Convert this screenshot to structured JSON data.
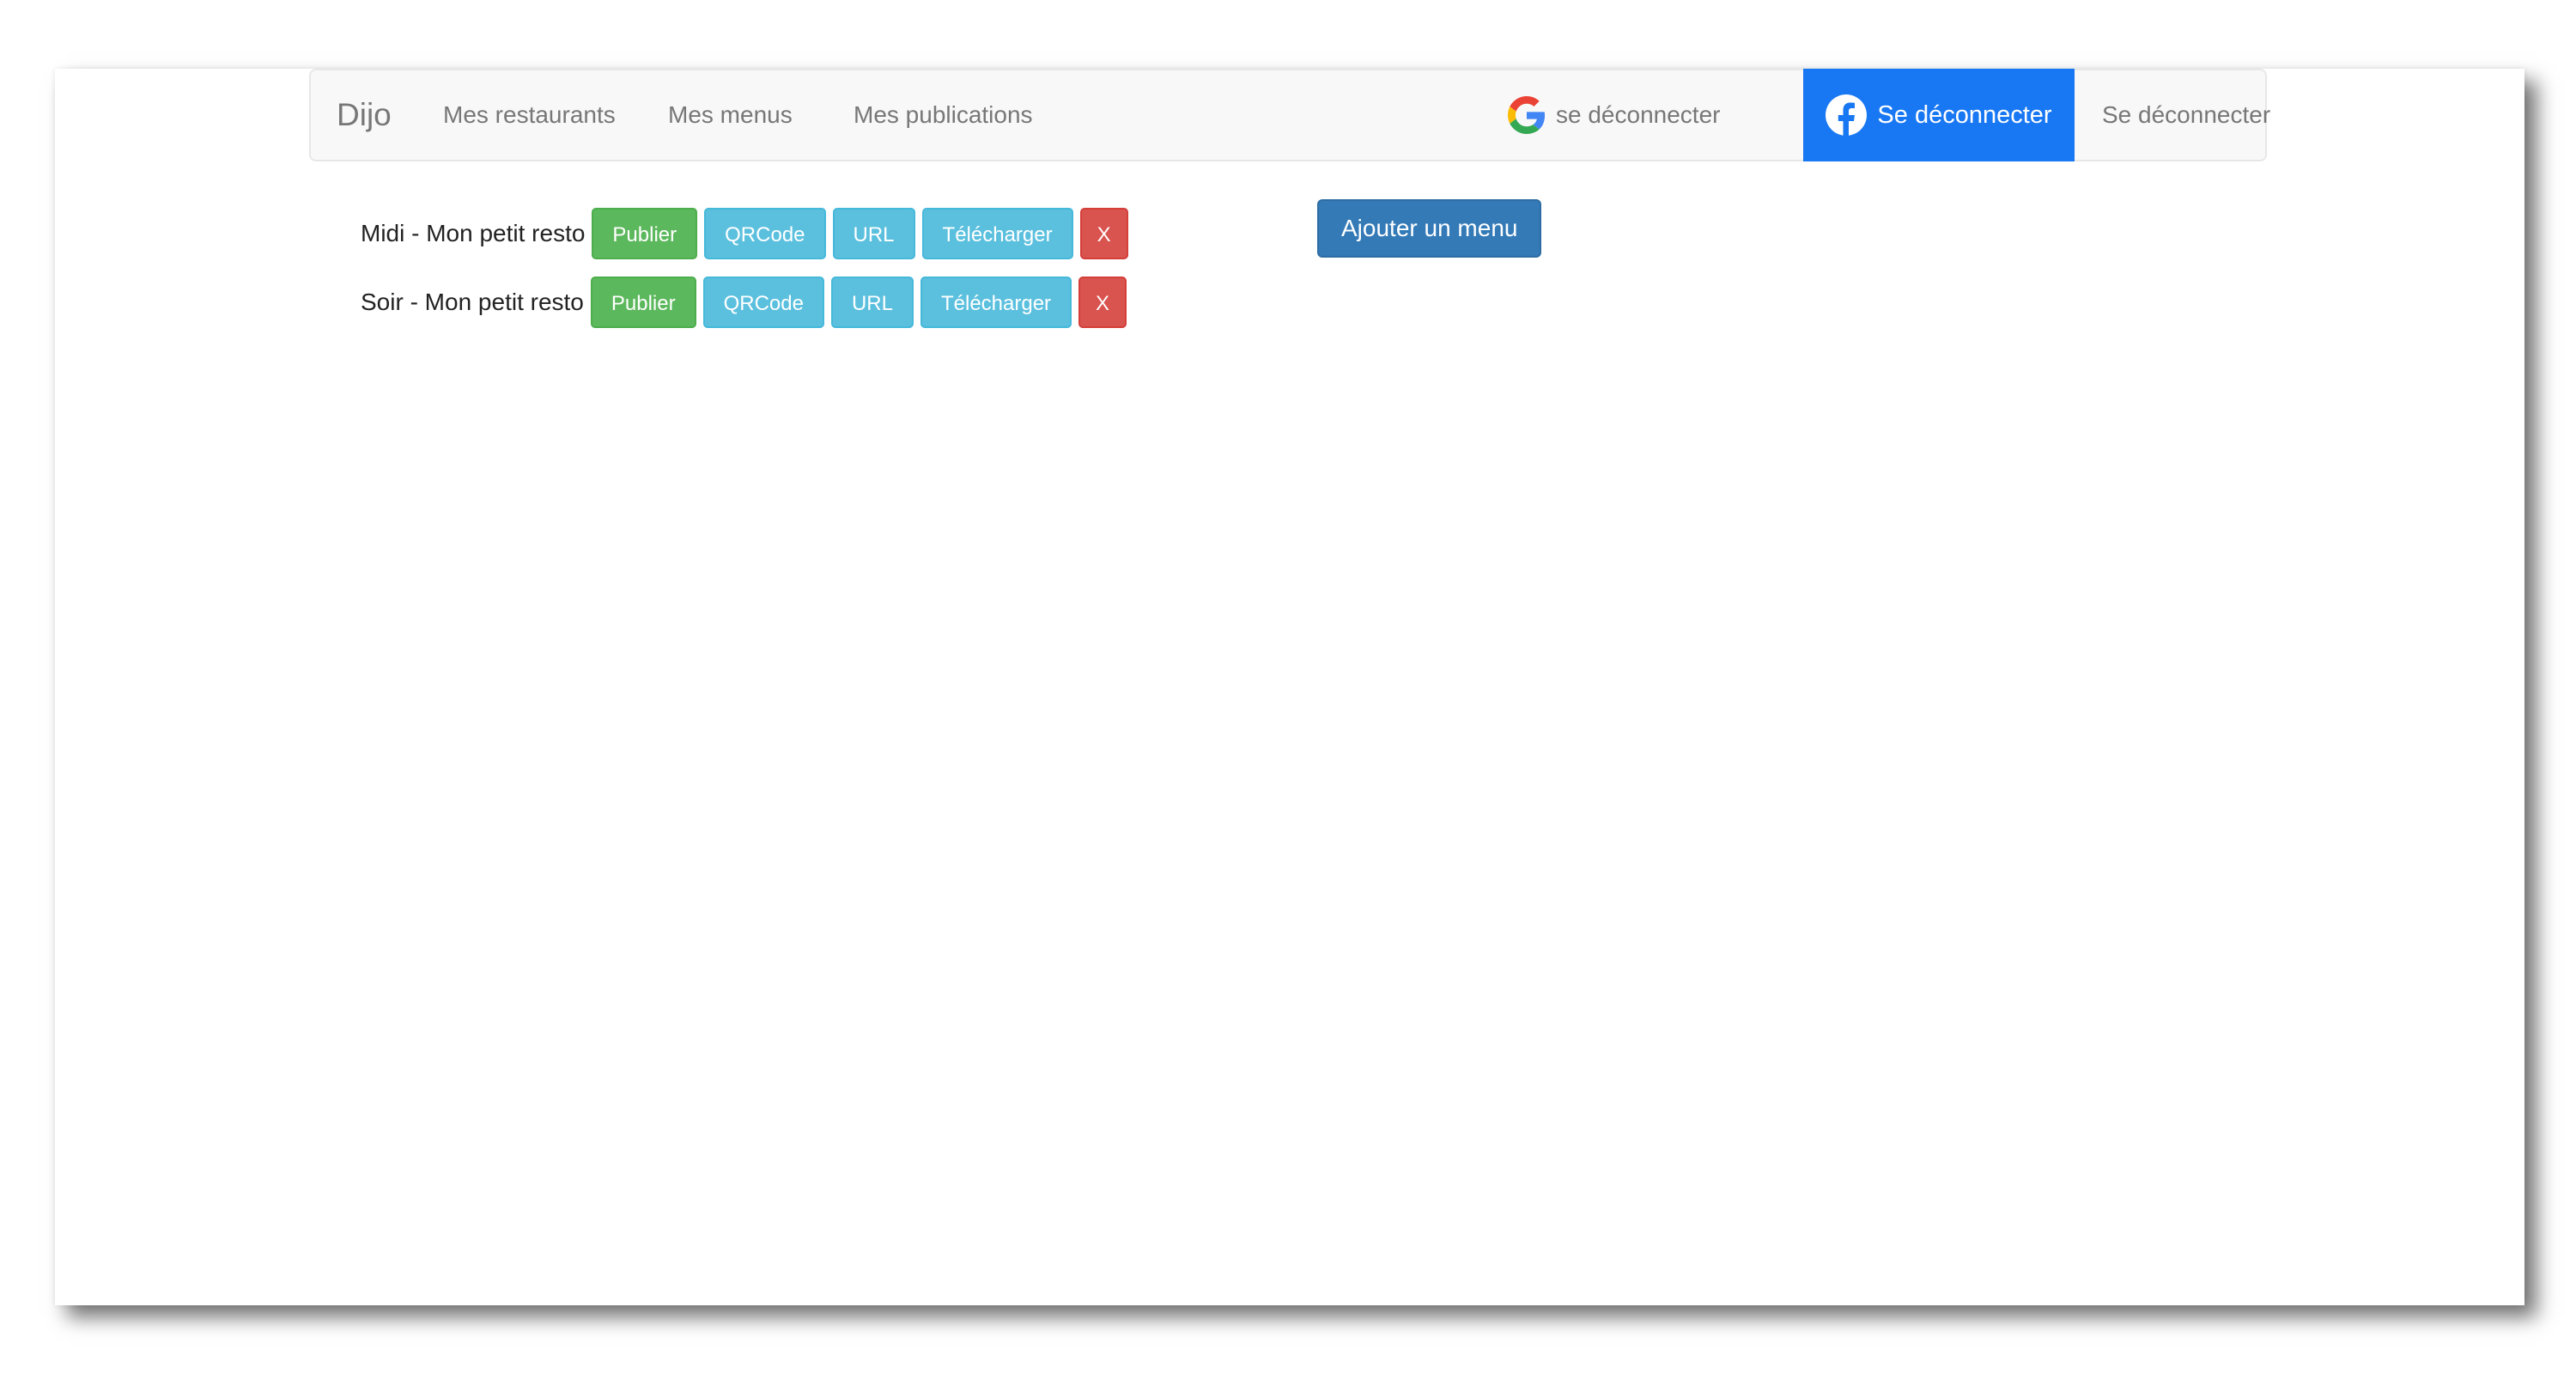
{
  "navbar": {
    "brand": "Dijo",
    "links": [
      "Mes restaurants",
      "Mes menus",
      "Mes publications"
    ],
    "google_logout": "se déconnecter",
    "facebook_logout": "Se déconnecter",
    "logout": "Se déconnecter",
    "facebook_color": "#1877f2"
  },
  "menus": [
    {
      "name": "Midi - Mon petit resto",
      "actions": [
        "Publier",
        "QRCode",
        "URL",
        "Télécharger",
        "X"
      ]
    },
    {
      "name": "Soir - Mon petit resto",
      "actions": [
        "Publier",
        "QRCode",
        "URL",
        "Télécharger",
        "X"
      ]
    }
  ],
  "add_menu_label": "Ajouter un menu",
  "colors": {
    "success": "#5cb85c",
    "info": "#5bc0de",
    "danger": "#d9534f",
    "primary": "#337ab7"
  }
}
